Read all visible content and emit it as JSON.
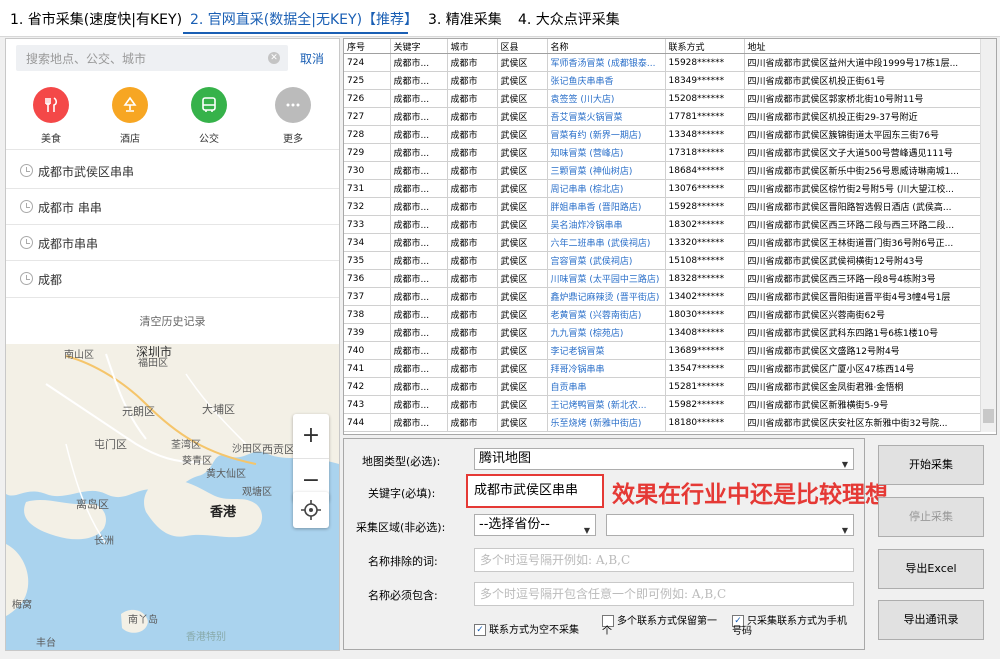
{
  "tabs": [
    {
      "label": "1. 省市采集(速度快|有KEY)"
    },
    {
      "label": "2. 官网直采(数据全|无KEY)【推荐】"
    },
    {
      "label": "3. 精准采集"
    },
    {
      "label": "4. 大众点评采集"
    }
  ],
  "left_panel": {
    "search_placeholder": "搜索地点、公交、城市",
    "cancel": "取消",
    "categories": [
      {
        "label": "美食",
        "icon": "fork-knife-icon",
        "color": "#f44848"
      },
      {
        "label": "酒店",
        "icon": "lamp-icon",
        "color": "#f7a623"
      },
      {
        "label": "公交",
        "icon": "bus-icon",
        "color": "#36b24a"
      },
      {
        "label": "更多",
        "icon": "more-icon",
        "color": "#bbbbbb"
      }
    ],
    "history": [
      "成都市武侯区串串",
      "成都市 串串",
      "成都市串串",
      "成都"
    ],
    "clear_history": "清空历史记录",
    "map_labels": [
      "南山区",
      "深圳市",
      "福田区",
      "元朗区",
      "大埔区",
      "屯门区",
      "荃湾区",
      "沙田区",
      "西贡区",
      "葵青区",
      "黄大仙区",
      "观塘区",
      "香港",
      "离岛区",
      "长洲",
      "南丫岛",
      "梅窝",
      "丰台",
      "香港特别"
    ]
  },
  "grid": {
    "columns": [
      "序号",
      "关键字",
      "城市",
      "区县",
      "名称",
      "联系方式",
      "地址"
    ],
    "rows": [
      [
        "724",
        "成都市...",
        "成都市",
        "武侯区",
        "军师香汤冒菜 (成都银泰...",
        "15928******",
        "四川省成都市武侯区益州大道中段1999号17栋1层..."
      ],
      [
        "725",
        "成都市...",
        "成都市",
        "武侯区",
        "张记鱼庆串串香",
        "18349******",
        "四川省成都市武侯区机投正街61号"
      ],
      [
        "726",
        "成都市...",
        "成都市",
        "武侯区",
        "袁签签 (川大店)",
        "15208******",
        "四川省成都市武侯区郭家桥北街10号附11号"
      ],
      [
        "727",
        "成都市...",
        "成都市",
        "武侯区",
        "吾艾冒菜火锅冒菜",
        "17781******",
        "四川省成都市武侯区机投正街29-37号附近"
      ],
      [
        "728",
        "成都市...",
        "成都市",
        "武侯区",
        "冒菜有约 (新界一期店)",
        "13348******",
        "四川省成都市武侯区簇锦街道太平园东三街76号"
      ],
      [
        "729",
        "成都市...",
        "成都市",
        "武侯区",
        "知味冒菜 (营峰店)",
        "17318******",
        "四川省成都市武侯区文子大道500号营峰遇见111号"
      ],
      [
        "730",
        "成都市...",
        "成都市",
        "武侯区",
        "三颗冒菜 (神仙树店)",
        "18684******",
        "四川省成都市武侯区新乐中街256号恩威诗琳南城1..."
      ],
      [
        "731",
        "成都市...",
        "成都市",
        "武侯区",
        "周记串串 (棕北店)",
        "13076******",
        "四川省成都市武侯区棕竹街2号附5号 (川大望江校..."
      ],
      [
        "732",
        "成都市...",
        "成都市",
        "武侯区",
        "胖姐串串香 (晋阳路店)",
        "15928******",
        "四川省成都市武侯区晋阳路智选假日酒店 (武侯高..."
      ],
      [
        "733",
        "成都市...",
        "成都市",
        "武侯区",
        "吴名油炸冷锅串串",
        "18302******",
        "四川省成都市武侯区西三环路二段与西三环路二段..."
      ],
      [
        "734",
        "成都市...",
        "成都市",
        "武侯区",
        "六年二班串串 (武侯祠店)",
        "13320******",
        "四川省成都市武侯区王林街道晋门街36号附6号正..."
      ],
      [
        "735",
        "成都市...",
        "成都市",
        "武侯区",
        "宫容冒菜 (武侯祠店)",
        "15108******",
        "四川省成都市武侯区武侯祠横街12号附43号"
      ],
      [
        "736",
        "成都市...",
        "成都市",
        "武侯区",
        "川味冒菜 (太平园中三路店)",
        "18328******",
        "四川省成都市武侯区西三环路一段8号4栋附3号"
      ],
      [
        "737",
        "成都市...",
        "成都市",
        "武侯区",
        "鑫炉鼎记麻辣烫 (晋平街店)",
        "13402******",
        "四川省成都市武侯区晋阳街道晋平街4号3幢4号1层"
      ],
      [
        "738",
        "成都市...",
        "成都市",
        "武侯区",
        "老黄冒菜 (兴蓉南街店)",
        "18030******",
        "四川省成都市武侯区兴蓉南街62号"
      ],
      [
        "739",
        "成都市...",
        "成都市",
        "武侯区",
        "九九冒菜 (棕苑店)",
        "13408******",
        "四川省成都市武侯区武科东四路1号6栋1楼10号"
      ],
      [
        "740",
        "成都市...",
        "成都市",
        "武侯区",
        "李记老锅冒菜",
        "13689******",
        "四川省成都市武侯区文盛路12号附4号"
      ],
      [
        "741",
        "成都市...",
        "成都市",
        "武侯区",
        "拜哥冷锅串串",
        "13547******",
        "四川省成都市武侯区广厦小区47栋西14号"
      ],
      [
        "742",
        "成都市...",
        "成都市",
        "武侯区",
        "自贡串串",
        "15281******",
        "四川省成都市武侯区金凤街君雅·金悟桐"
      ],
      [
        "743",
        "成都市...",
        "成都市",
        "武侯区",
        "王记烤鸭冒菜 (新北农...",
        "15982******",
        "四川省成都市武侯区新雅横街5-9号"
      ],
      [
        "744",
        "成都市...",
        "成都市",
        "武侯区",
        "乐至烧烤 (新雅中街店)",
        "18180******",
        "四川省成都市武侯区庆安社区东新雅中街32号院..."
      ]
    ]
  },
  "controls": {
    "map_type_label": "地图类型(必选):",
    "map_type_value": "腾讯地图",
    "keyword_label": "关键字(必填):",
    "keyword_value": "成都市武侯区串串",
    "promo_text": "效果在行业中还是比较理想",
    "region_label": "采集区域(非必选):",
    "province_value": "--选择省份--",
    "city_value": "",
    "exclude_label": "名称排除的词:",
    "exclude_placeholder": "多个时逗号隔开例如: A,B,C",
    "include_label": "名称必须包含:",
    "include_placeholder": "多个时逗号隔开包含任意一个即可例如: A,B,C",
    "check1": "联系方式为空不采集",
    "check2": "多个联系方式保留第一个",
    "check3": "只采集联系方式为手机号码"
  },
  "buttons": {
    "start": "开始采集",
    "stop": "停止采集",
    "export_excel": "导出Excel",
    "export_contacts": "导出通讯录"
  },
  "colors": {
    "accent": "#1a5fb4",
    "highlight": "#e53935",
    "link": "#2a6fc9"
  }
}
